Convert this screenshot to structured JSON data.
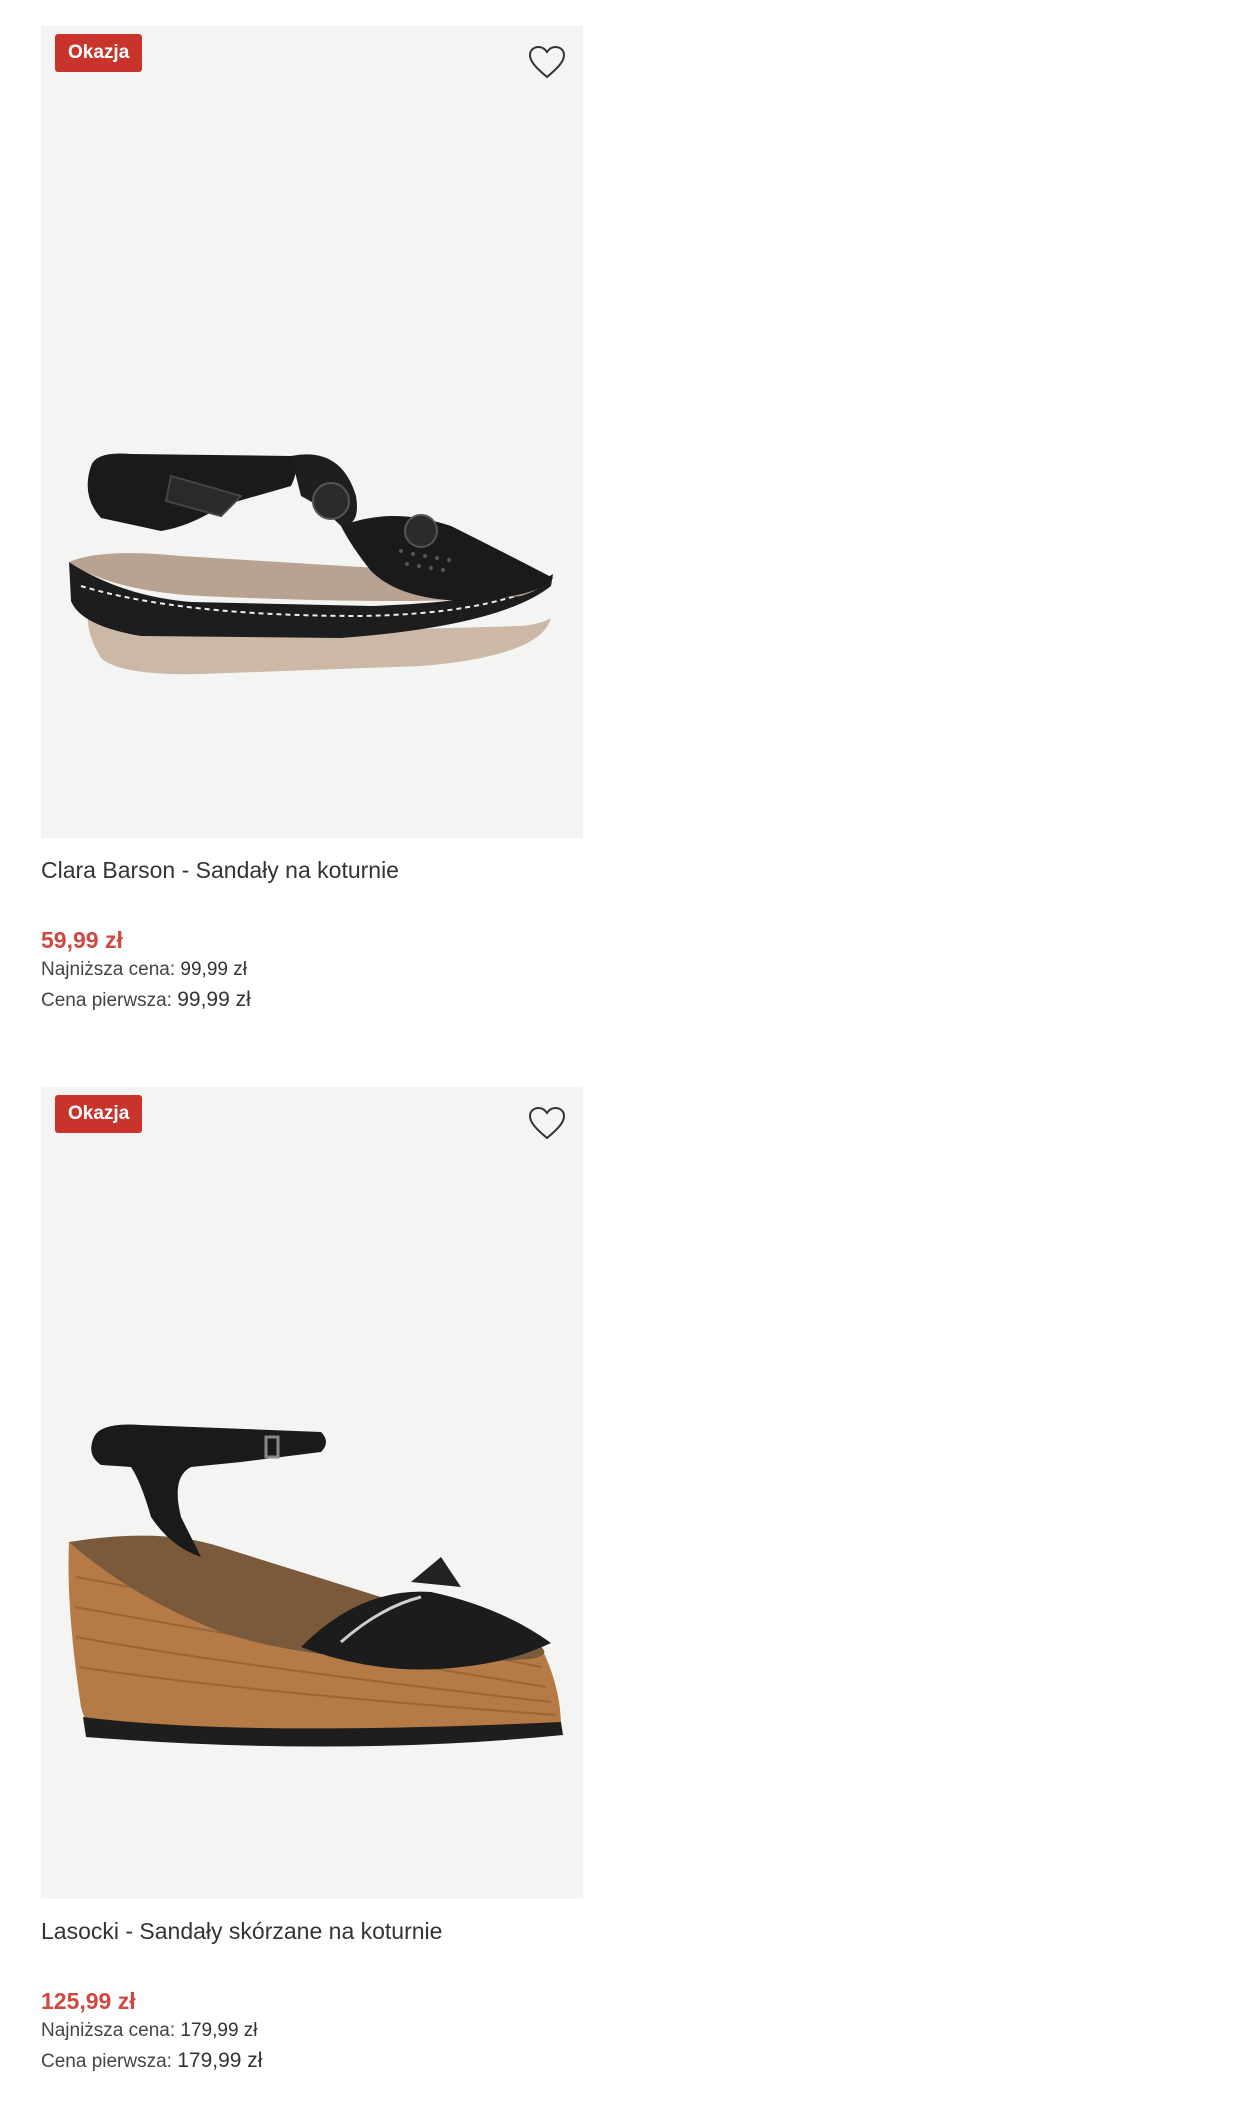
{
  "colors": {
    "badge_bg": "#c8342c",
    "price": "#d04840",
    "image_bg": "#f4f4f3"
  },
  "products": [
    {
      "badge": "Okazja",
      "wishlist_icon": "heart-outline-icon",
      "image": "black-wedge-sandal-with-flower",
      "title": "Clara Barson - Sandały na koturnie",
      "price": "59,99 zł",
      "lowest_label": "Najniższa cena:",
      "lowest_value": "99,99 zł",
      "original_label": "Cena pierwsza:",
      "original_value": "99,99 zł"
    },
    {
      "badge": "Okazja",
      "wishlist_icon": "heart-outline-icon",
      "image": "black-leather-cork-wedge-sandal",
      "title": "Lasocki - Sandały skórzane na koturnie",
      "price": "125,99 zł",
      "lowest_label": "Najniższa cena:",
      "lowest_value": "179,99 zł",
      "original_label": "Cena pierwsza:",
      "original_value": "179,99 zł"
    }
  ]
}
